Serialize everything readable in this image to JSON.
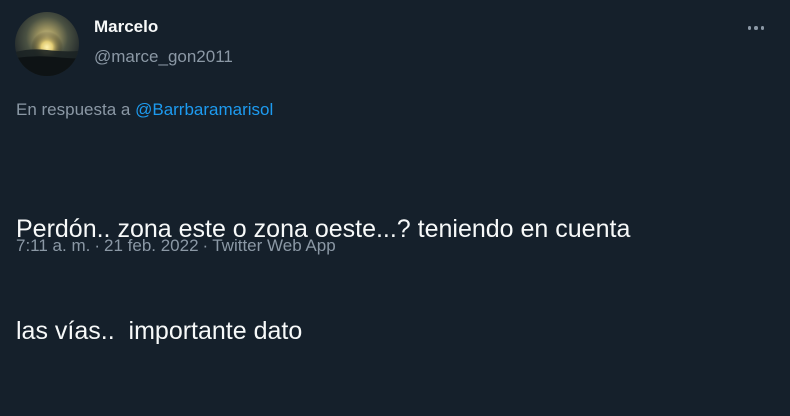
{
  "author": {
    "display_name": "Marcelo",
    "handle": "@marce_gon2011"
  },
  "reply": {
    "prefix": "En respuesta a",
    "mention": "@Barrbaramarisol"
  },
  "tweet": {
    "line1": "Perdón.. zona este o zona oeste...? teniendo en cuenta",
    "line2": "las vías..  importante dato"
  },
  "meta": {
    "time": "7:11 a. m.",
    "date": "21 feb. 2022",
    "source": "Twitter Web App",
    "separator": "·"
  },
  "icons": {
    "more": "more-horizontal-icon"
  },
  "colors": {
    "background": "#15202b",
    "text": "#f7f9f9",
    "secondary": "#8b98a5",
    "accent": "#1d9bf0"
  }
}
